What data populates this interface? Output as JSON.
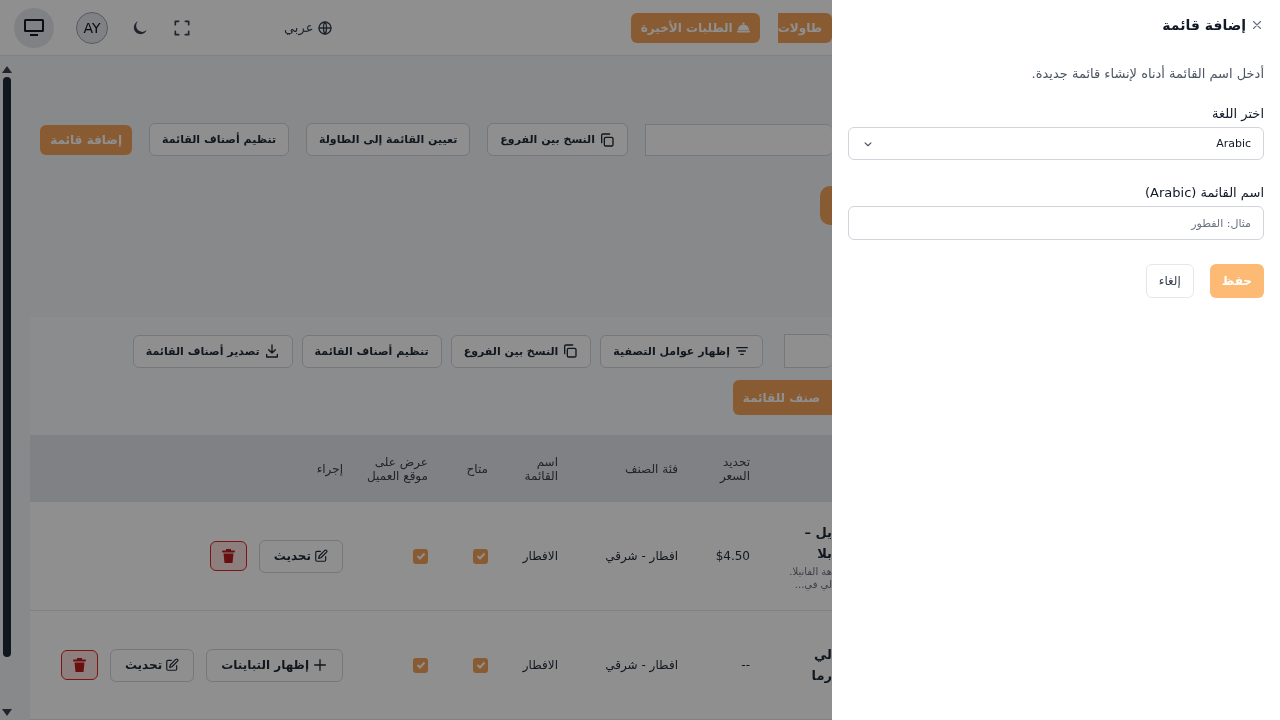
{
  "header": {
    "buttons": [
      {
        "label": "طاولات"
      },
      {
        "label": "الطلبات الأخيرة"
      }
    ],
    "language": "عربي",
    "avatar": "AY"
  },
  "toolbar": {
    "buttons": [
      {
        "label": "النسخ بين الفروع",
        "kind": "copy"
      },
      {
        "label": "تعيين القائمة إلى الطاولة",
        "kind": "outline"
      },
      {
        "label": "تنظيم أصناف القائمة",
        "kind": "outline"
      },
      {
        "label": "إضافة قائمة",
        "kind": "primary"
      }
    ]
  },
  "items_panel": {
    "buttons": [
      {
        "label": "إظهار عوامل التصفية",
        "kind": "filter"
      },
      {
        "label": "النسخ بين الفروع",
        "kind": "copy"
      },
      {
        "label": "تنظيم أصناف القائمة",
        "kind": "outline"
      },
      {
        "label": "تصدير أصناف القائمة",
        "kind": "export"
      }
    ],
    "add_button": "صنف للقائمة"
  },
  "table": {
    "columns": [
      "تحديد السعر",
      "فئة الصنف",
      "اسم القائمة",
      "متاح",
      "عرض على موقع العميل",
      "إجراء"
    ],
    "rows": [
      {
        "name": [
          "يل –",
          "بلا"
        ],
        "description": [
          "هة الفانيلا.",
          "لي في..."
        ],
        "price": "$4.50",
        "category": "افطار - شرقي",
        "menu": "الافطار",
        "available": true,
        "on_website": true,
        "actions": [
          {
            "kind": "update",
            "label": "تحديث"
          },
          {
            "kind": "delete"
          }
        ]
      },
      {
        "name": [
          "لي",
          "رما"
        ],
        "description": [],
        "price": "--",
        "category": "افطار - شرقي",
        "menu": "الافطار",
        "available": true,
        "on_website": true,
        "actions": [
          {
            "kind": "variants",
            "label": "إظهار التباينات"
          },
          {
            "kind": "update",
            "label": "تحديث"
          },
          {
            "kind": "delete"
          }
        ]
      }
    ]
  },
  "drawer": {
    "title": "إضافة قائمة",
    "description": "أدخل اسم القائمة أدناه لإنشاء قائمة جديدة.",
    "language_label": "اختر اللغة",
    "language_value": "Arabic",
    "name_label": "اسم القائمة (Arabic)",
    "name_placeholder": "مثال: الفطور",
    "save": "حفظ",
    "cancel": "إلغاء"
  }
}
